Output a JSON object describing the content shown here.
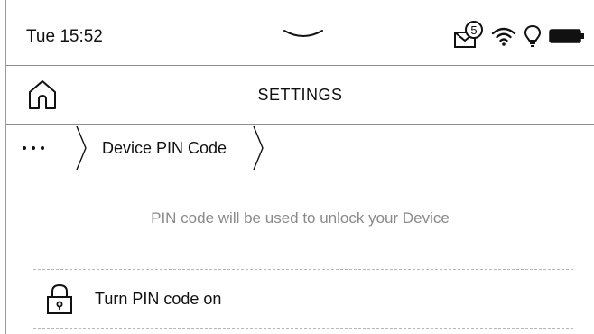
{
  "status_bar": {
    "time": "Tue 15:52",
    "notification_count": "5",
    "icons": [
      "mail-icon",
      "wifi-icon",
      "frontlight-icon",
      "battery-icon"
    ]
  },
  "header": {
    "title": "SETTINGS",
    "home_icon": "home-icon"
  },
  "breadcrumb": {
    "more_icon": "more-dots-icon",
    "current": "Device PIN Code"
  },
  "content": {
    "description": "PIN code will be used to unlock your Device",
    "pin_toggle": {
      "label": "Turn PIN code on",
      "icon": "lock-icon"
    }
  }
}
